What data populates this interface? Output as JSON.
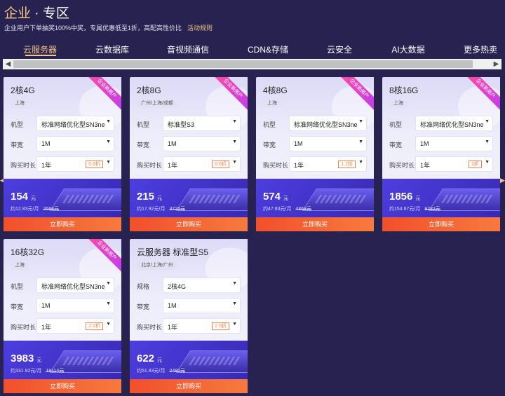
{
  "header": {
    "title_prefix": "企业",
    "title_suffix": "· 专区",
    "subtitle": "企业用户下单抽奖100%中奖，专属优惠低至1折，高配高性价比",
    "rules_link": "活动规则"
  },
  "tabs": [
    {
      "label": "云服务器",
      "active": true
    },
    {
      "label": "云数据库"
    },
    {
      "label": "音视频通信"
    },
    {
      "label": "CDN&存储"
    },
    {
      "label": "云安全"
    },
    {
      "label": "AI大数据"
    },
    {
      "label": "更多热卖"
    }
  ],
  "scrollbar": {
    "left_arrow": "◀",
    "right_arrow": "▶"
  },
  "edge_arrows": {
    "left": "◀",
    "right": "▶"
  },
  "ribbon_text": "企业新用户",
  "labels": {
    "model": "机型",
    "spec": "规格",
    "bandwidth": "带宽",
    "duration": "购买时长",
    "currency": "元",
    "buy": "立即购买",
    "caret": "▼"
  },
  "cards": [
    {
      "title": "2核4G",
      "region": "上海",
      "first_label": "机型",
      "first_value": "标准网络优化型SN3ne",
      "bandwidth": "1M",
      "duration": "1年",
      "discount": "0.6折",
      "price": "154",
      "per_month": "约12.83元/月",
      "original": "2688元"
    },
    {
      "title": "2核8G",
      "region": "广州/上海/成都",
      "first_label": "机型",
      "first_value": "标准型S3",
      "bandwidth": "1M",
      "duration": "1年",
      "discount": "0.6折",
      "price": "215",
      "per_month": "约17.92元/月",
      "original": "3726元"
    },
    {
      "title": "4核8G",
      "region": "上海",
      "first_label": "机型",
      "first_value": "标准网络优化型SN3ne",
      "bandwidth": "1M",
      "duration": "1年",
      "discount": "1.2折",
      "price": "574",
      "per_month": "约47.83元/月",
      "original": "4868元"
    },
    {
      "title": "8核16G",
      "region": "上海",
      "first_label": "机型",
      "first_value": "标准网络优化型SN3ne",
      "bandwidth": "1M",
      "duration": "1年",
      "discount": "2折",
      "price": "1856",
      "per_month": "约154.67元/月",
      "original": "9282元"
    },
    {
      "title": "16核32G",
      "region": "上海",
      "first_label": "机型",
      "first_value": "标准网络优化型SN3ne",
      "bandwidth": "1M",
      "duration": "1年",
      "discount": "2.2折",
      "price": "3983",
      "per_month": "约331.92元/月",
      "original": "18114元"
    },
    {
      "title": "云服务器 标准型S5",
      "region": "北京/上海/广州",
      "first_label": "规格",
      "first_value": "2核4G",
      "bandwidth": "1M",
      "duration": "1年",
      "discount": "2.5折",
      "price": "622",
      "per_month": "约51.83元/月",
      "original": "2490元"
    }
  ]
}
